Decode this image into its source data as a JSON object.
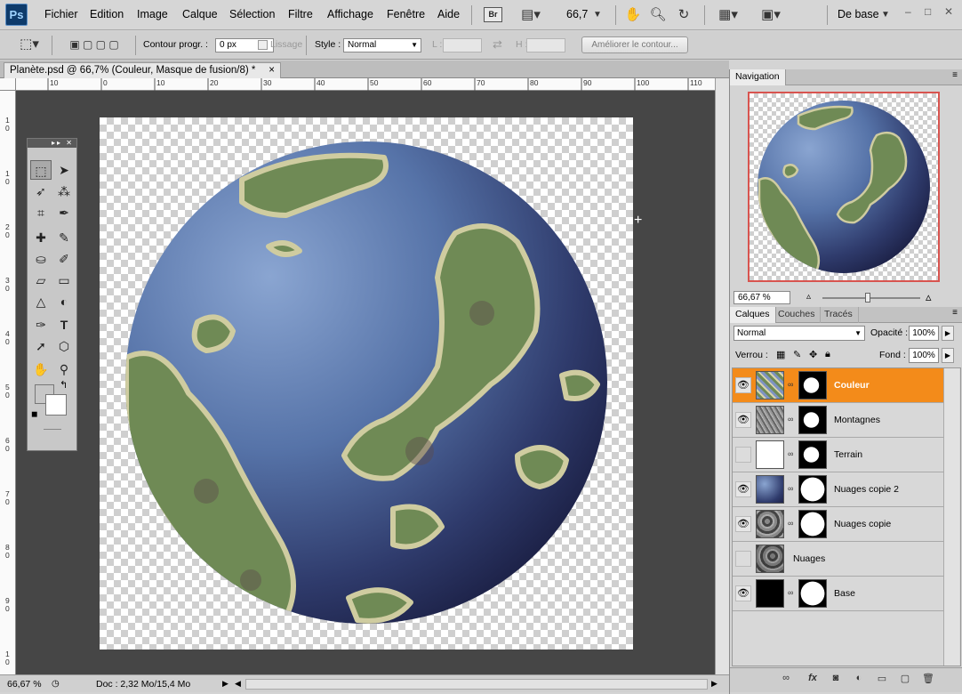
{
  "app": {
    "logo": "Ps",
    "workspace": "De base"
  },
  "menu": [
    "Fichier",
    "Edition",
    "Image",
    "Calque",
    "Sélection",
    "Filtre",
    "Affichage",
    "Fenêtre",
    "Aide"
  ],
  "menubar": {
    "bridge": "Br",
    "zoom": "66,7"
  },
  "options": {
    "feather_label": "Contour progr. :",
    "feather_value": "0 px",
    "antialias_label": "Lissage",
    "style_label": "Style :",
    "style_value": "Normal",
    "width_label": "L :",
    "height_label": "H :",
    "refine_button": "Améliorer le contour..."
  },
  "document": {
    "tab_title": "Planète.psd @ 66,7% (Couleur, Masque de fusion/8) *",
    "close": "×"
  },
  "rulers": {
    "h": [
      "10",
      "0",
      "10",
      "20",
      "30",
      "40",
      "50",
      "60",
      "70",
      "80",
      "90",
      "100",
      "110"
    ],
    "v": [
      "1",
      "0",
      "1",
      "0",
      "2",
      "0",
      "3",
      "0",
      "4",
      "0",
      "5",
      "0",
      "6",
      "0",
      "7",
      "0",
      "8",
      "0",
      "9",
      "0",
      "1",
      "0"
    ]
  },
  "status": {
    "zoom": "66,67 %",
    "doc": "Doc : 2,32 Mo/15,4 Mo"
  },
  "navigator": {
    "title": "Navigation",
    "zoom": "66,67 %"
  },
  "layers_panel": {
    "tabs": [
      "Calques",
      "Couches",
      "Tracés"
    ],
    "blend_mode": "Normal",
    "opacity_label": "Opacité :",
    "opacity_value": "100%",
    "lock_label": "Verrou :",
    "fill_label": "Fond :",
    "fill_value": "100%",
    "layers": [
      {
        "name": "Couleur",
        "visible": true,
        "selected": true
      },
      {
        "name": "Montagnes",
        "visible": true,
        "selected": false
      },
      {
        "name": "Terrain",
        "visible": false,
        "selected": false
      },
      {
        "name": "Nuages copie 2",
        "visible": true,
        "selected": false
      },
      {
        "name": "Nuages copie",
        "visible": true,
        "selected": false
      },
      {
        "name": "Nuages",
        "visible": false,
        "selected": false
      },
      {
        "name": "Base",
        "visible": true,
        "selected": false
      }
    ]
  },
  "colors": {
    "accent": "#f38b1a",
    "planet_ocean": "#5b7bb0",
    "land": "#6f8a55",
    "nav_frame": "#d8544f"
  }
}
